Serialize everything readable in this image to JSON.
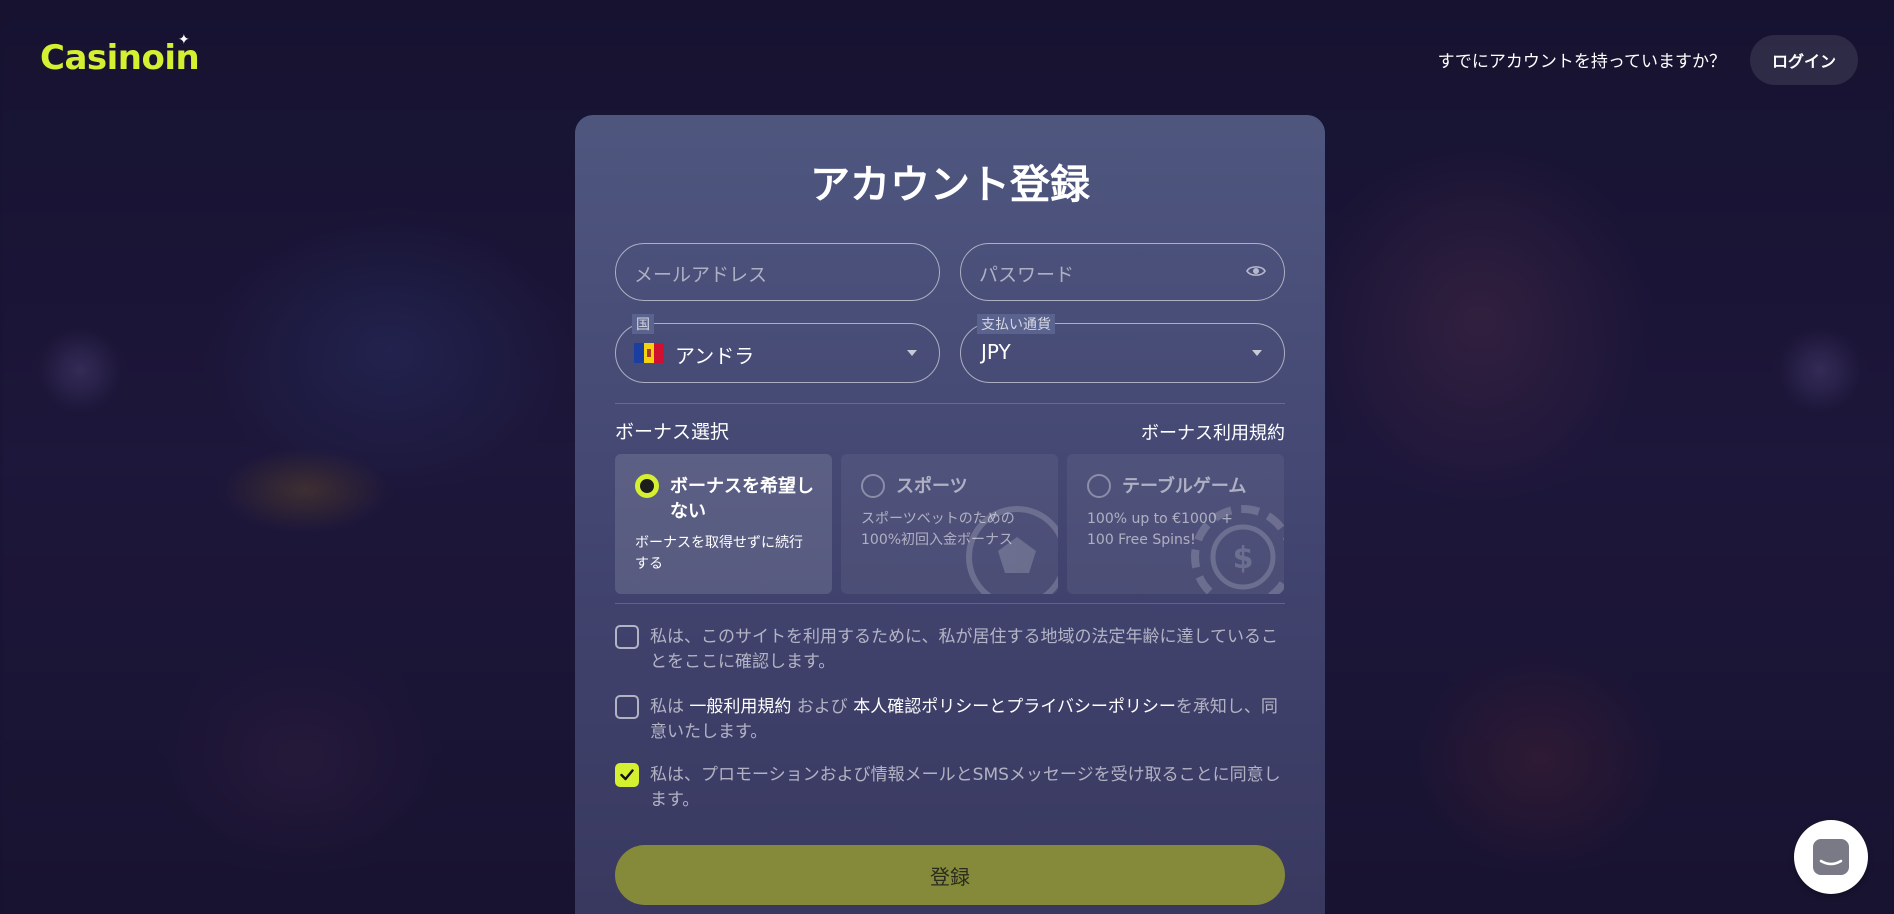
{
  "header": {
    "logo_text": "Casinoin",
    "has_account_text": "すでにアカウントを持っていますか？",
    "login_label": "ログイン"
  },
  "form": {
    "title": "アカウント登録",
    "email": {
      "placeholder": "メールアドレス",
      "value": ""
    },
    "password": {
      "placeholder": "パスワード",
      "value": ""
    },
    "country": {
      "label": "国",
      "value": "アンドラ",
      "flag": "andorra-flag"
    },
    "currency": {
      "label": "支払い通貨",
      "value": "JPY"
    }
  },
  "bonus": {
    "label": "ボーナス選択",
    "terms_link": "ボーナス利用規約",
    "options": [
      {
        "title": "ボーナスを希望しない",
        "desc": "ボーナスを取得せずに続行する",
        "selected": true
      },
      {
        "title": "スポーツ",
        "desc": "スポーツベットのための100%初回入金ボーナス",
        "selected": false
      },
      {
        "title": "テーブルゲーム",
        "desc": "100% up to €1000 + 100 Free Spins!",
        "selected": false
      }
    ]
  },
  "checks": {
    "age": {
      "text": "私は、このサイトを利用するために、私が居住する地域の法定年齢に達していることをここに確認します。",
      "checked": false
    },
    "terms": {
      "prefix": "私は ",
      "link1": "一般利用規約",
      "mid": " および ",
      "link2": "本人確認ポリシーとプライバシーポリシー",
      "suffix": "を承知し、同意いたします。",
      "checked": false
    },
    "promo": {
      "text": "私は、プロモーションおよび情報メールとSMSメッセージを受け取ることに同意します。",
      "checked": true
    }
  },
  "submit_label": "登録",
  "colors": {
    "accent": "#d4f030",
    "submit_bg": "#848a3a",
    "card_bg": "#565d8a"
  }
}
